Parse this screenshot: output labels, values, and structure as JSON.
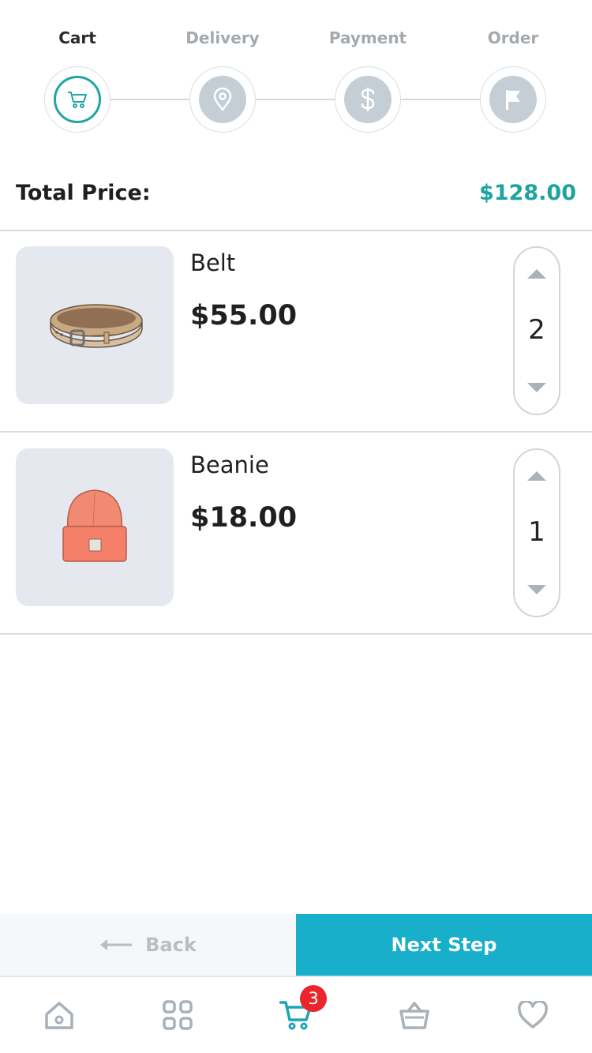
{
  "steps": [
    {
      "label": "Cart",
      "icon": "cart-icon",
      "active": true
    },
    {
      "label": "Delivery",
      "icon": "location-pin-icon",
      "active": false
    },
    {
      "label": "Payment",
      "icon": "dollar-icon",
      "active": false
    },
    {
      "label": "Order",
      "icon": "flag-icon",
      "active": false
    }
  ],
  "total": {
    "label": "Total Price:",
    "value": "$128.00"
  },
  "items": [
    {
      "name": "Belt",
      "price": "$55.00",
      "quantity": "2",
      "image": "belt-image"
    },
    {
      "name": "Beanie",
      "price": "$18.00",
      "quantity": "1",
      "image": "beanie-image"
    }
  ],
  "footer": {
    "back_label": "Back",
    "next_label": "Next Step"
  },
  "nav": {
    "items": [
      "home-icon",
      "grid-icon",
      "cart-icon",
      "basket-icon",
      "heart-icon"
    ],
    "cart_badge": "3",
    "active": "cart-icon"
  },
  "colors": {
    "accent": "#1ea3a0",
    "next_button": "#17afc9",
    "badge": "#e8262b",
    "inactive_step": "#c5ced5"
  }
}
